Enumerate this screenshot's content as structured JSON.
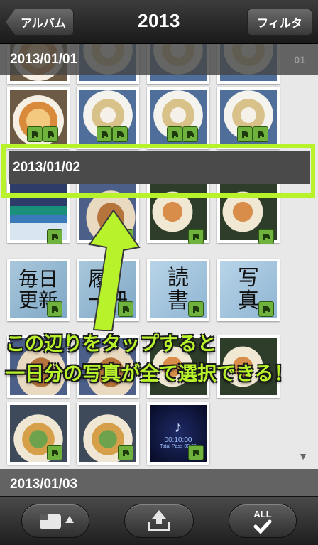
{
  "nav": {
    "back_label": "アルバム",
    "title": "2013",
    "filter_label": "フィルタ"
  },
  "sections": [
    {
      "date": "2013/01/01",
      "page_mark": "01"
    },
    {
      "date": "2013/01/02"
    },
    {
      "date": "2013/01/03"
    }
  ],
  "overlay": {
    "line1": "この辺りをタップすると",
    "line2": "一日分の写真が全て選択できる！"
  },
  "thumbs": {
    "kanji": [
      "毎日\n更新",
      "履\n一冊",
      "読\n書",
      "写\n真"
    ],
    "clock_time": "00:10:00",
    "clock_sub": "Total Pass 00:09"
  },
  "toolbar": {
    "all_label": "ALL"
  },
  "colors": {
    "highlight": "#b7f22a",
    "badge": "#6fb33e",
    "navbar": "#2a2a2a"
  }
}
